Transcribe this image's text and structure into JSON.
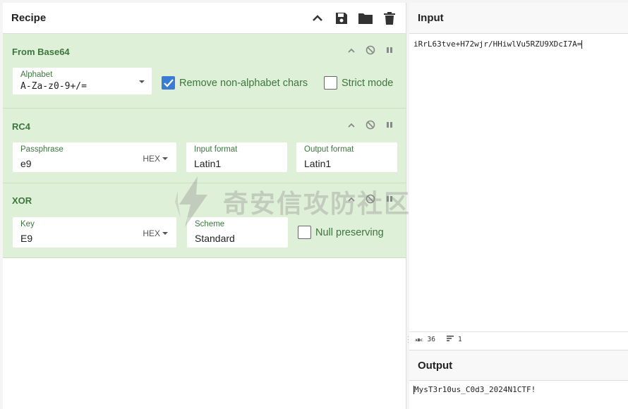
{
  "recipe": {
    "title": "Recipe",
    "icons": [
      "chevron-up-icon",
      "save-icon",
      "folder-icon",
      "trash-icon"
    ]
  },
  "operations": {
    "from_base64": {
      "title": "From Base64",
      "alphabet_label": "Alphabet",
      "alphabet_value": "A-Za-z0-9+/=",
      "remove_label": "Remove non-alphabet chars",
      "remove_checked": true,
      "strict_label": "Strict mode",
      "strict_checked": false
    },
    "rc4": {
      "title": "RC4",
      "passphrase_label": "Passphrase",
      "passphrase_value": "e9",
      "passphrase_format": "HEX",
      "input_format_label": "Input format",
      "input_format_value": "Latin1",
      "output_format_label": "Output format",
      "output_format_value": "Latin1"
    },
    "xor": {
      "title": "XOR",
      "key_label": "Key",
      "key_value": "E9",
      "key_format": "HEX",
      "scheme_label": "Scheme",
      "scheme_value": "Standard",
      "null_label": "Null preserving",
      "null_checked": false
    }
  },
  "input": {
    "title": "Input",
    "text": "iRrL63tve+H72wjr/HHiwlVu5RZU9XDcI7A=",
    "length": "36",
    "lines": "1"
  },
  "output": {
    "title": "Output",
    "text": "MysT3r10us_C0d3_2024N1CTF!"
  },
  "watermark": {
    "text": "奇安信攻防社区"
  },
  "colors": {
    "accent_green": "#3c763d",
    "op_background": "#dff0d8",
    "checkbox_blue": "#3a7bd5"
  }
}
